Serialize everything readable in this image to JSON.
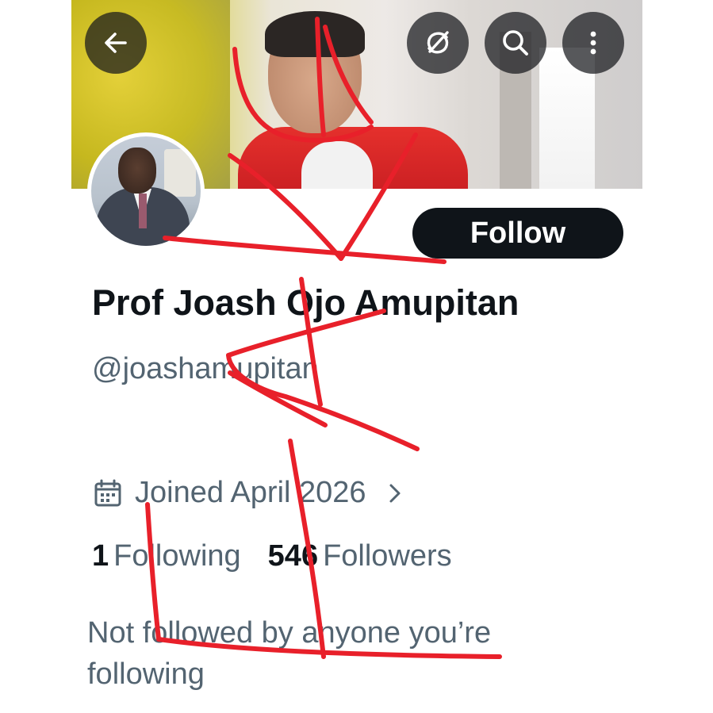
{
  "profile": {
    "display_name": "Prof Joash Ojo Amupitan",
    "handle": "@joashamupitan",
    "joined": "Joined April 2026",
    "following_count": "1",
    "following_label": "Following",
    "followers_count": "546",
    "followers_label": "Followers",
    "not_followed": "Not followed by anyone you’re following"
  },
  "actions": {
    "follow_label": "Follow"
  },
  "icons": {
    "back": "arrow-left-icon",
    "grok": "grok-icon",
    "search": "search-icon",
    "more": "more-vertical-icon",
    "calendar": "calendar-icon",
    "chevron": "chevron-right-icon"
  },
  "colors": {
    "primary_text": "#0f1419",
    "secondary_text": "#536471",
    "follow_button_bg": "#0f1419",
    "follow_button_text": "#ffffff",
    "scribble": "#e8202a"
  }
}
